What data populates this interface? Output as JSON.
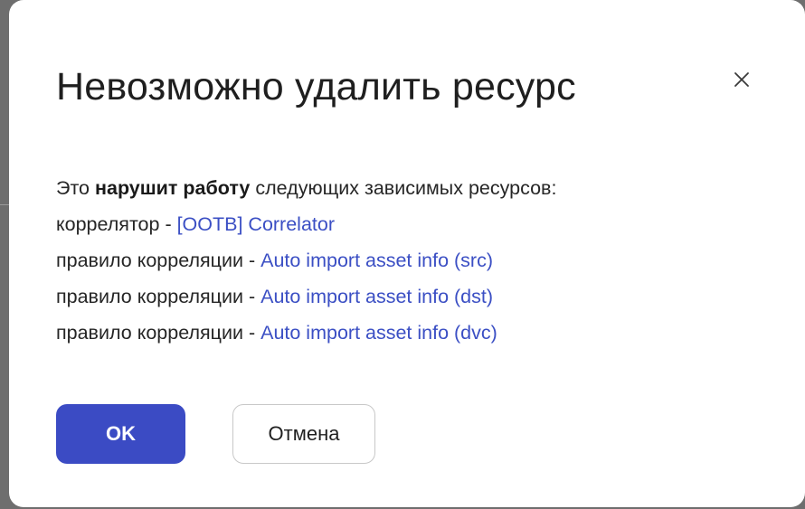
{
  "dialog": {
    "title": "Невозможно удалить ресурс",
    "close_icon": "close-icon",
    "intro": {
      "prefix": "Это ",
      "emphasis": "нарушит работу",
      "suffix": " следующих зависимых ресурсов:"
    },
    "dependencies": [
      {
        "type": "коррелятор - ",
        "name": "[OOTB] Correlator"
      },
      {
        "type": "правило корреляции - ",
        "name": "Auto import asset info (src)"
      },
      {
        "type": "правило корреляции - ",
        "name": "Auto import asset info (dst)"
      },
      {
        "type": "правило корреляции - ",
        "name": "Auto import asset info (dvc)"
      }
    ],
    "ok_label": "OK",
    "cancel_label": "Отмена"
  },
  "colors": {
    "primary": "#3b4bc4",
    "link": "#3b4fc4",
    "backdrop": "#6e6e6e"
  }
}
